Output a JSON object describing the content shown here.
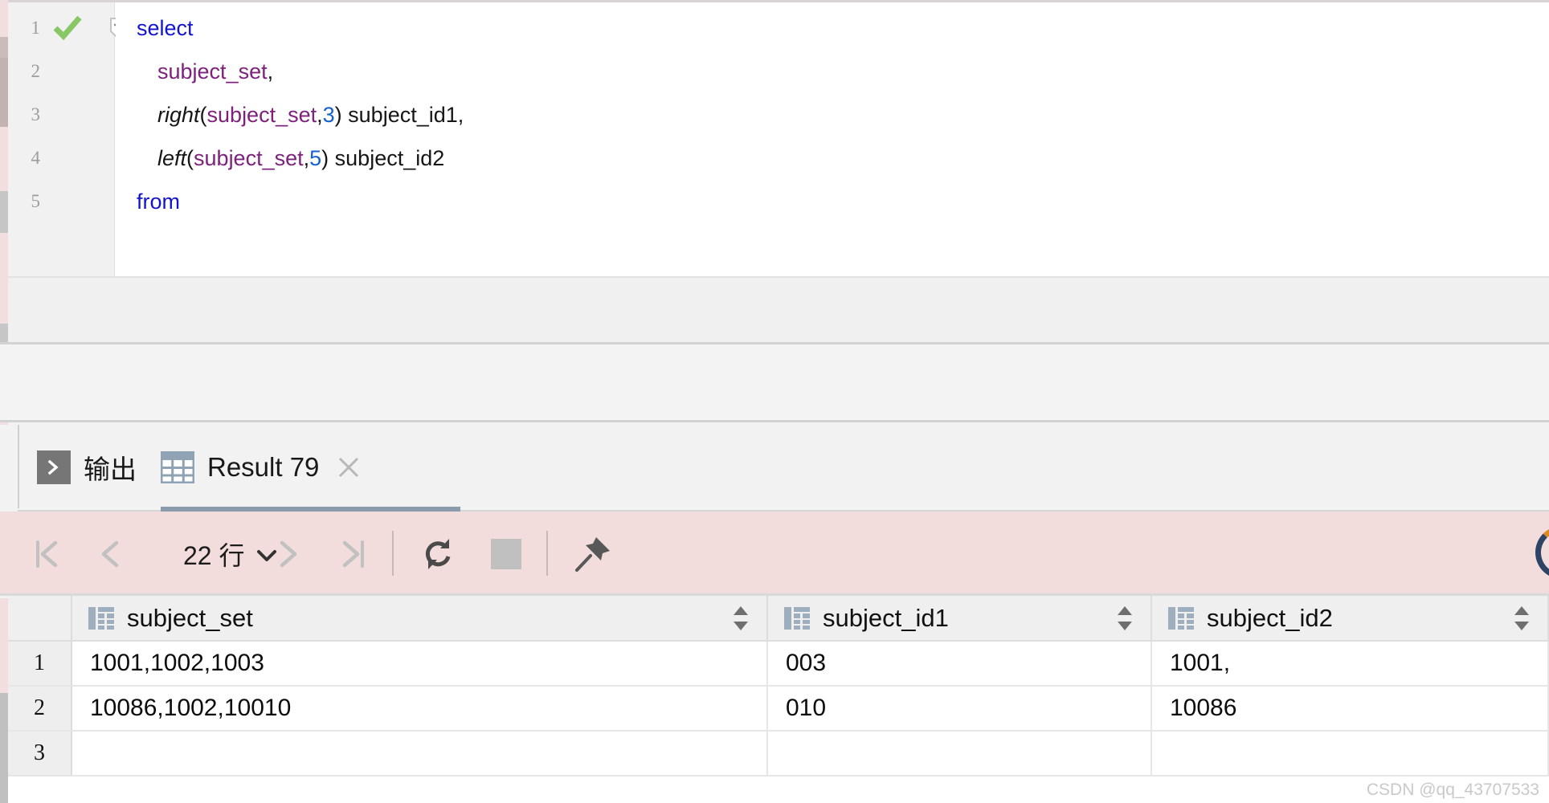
{
  "editor": {
    "lines": [
      {
        "number": "1",
        "indent": 0,
        "has_check": true,
        "has_fold": true,
        "tokens": [
          {
            "t": "select",
            "c": "kw"
          }
        ]
      },
      {
        "number": "2",
        "indent": 26,
        "has_check": false,
        "has_fold": false,
        "tokens": [
          {
            "t": "subject_set",
            "c": "ident"
          },
          {
            "t": ",",
            "c": "plain"
          }
        ]
      },
      {
        "number": "3",
        "indent": 26,
        "has_check": false,
        "has_fold": false,
        "tokens": [
          {
            "t": "right",
            "c": "fn"
          },
          {
            "t": "(",
            "c": "plain"
          },
          {
            "t": "subject_set",
            "c": "ident"
          },
          {
            "t": ",",
            "c": "plain"
          },
          {
            "t": "3",
            "c": "num"
          },
          {
            "t": ") subject_id1,",
            "c": "plain"
          }
        ]
      },
      {
        "number": "4",
        "indent": 26,
        "has_check": false,
        "has_fold": false,
        "tokens": [
          {
            "t": "left",
            "c": "fn"
          },
          {
            "t": "(",
            "c": "plain"
          },
          {
            "t": "subject_set",
            "c": "ident"
          },
          {
            "t": ",",
            "c": "plain"
          },
          {
            "t": "5",
            "c": "num"
          },
          {
            "t": ") subject_id2",
            "c": "plain"
          }
        ]
      },
      {
        "number": "5",
        "indent": 0,
        "has_check": false,
        "has_fold": false,
        "tokens": [
          {
            "t": "from",
            "c": "kw"
          }
        ]
      }
    ],
    "icons": {
      "check": "check-icon",
      "fold": "fold-collapse-icon"
    }
  },
  "tabs": [
    {
      "label": "输出",
      "icon": "console-icon",
      "active": false,
      "closable": false
    },
    {
      "label": "Result 79",
      "icon": "grid-icon",
      "active": true,
      "closable": true
    }
  ],
  "result_toolbar": {
    "first_page": "first-page-icon",
    "prev_page": "prev-page-icon",
    "rows_label": "22 行",
    "rows_chevron": "chevron-down-icon",
    "next_page": "next-page-icon",
    "last_page": "last-page-icon",
    "refresh": "refresh-icon",
    "stop": "stop-icon",
    "pin": "pin-icon",
    "busy_spinner": "loading-spinner-icon",
    "background_color": "#f2dcdc"
  },
  "result_grid": {
    "columns": [
      {
        "name": "subject_set",
        "icon": "column-icon",
        "sortable": true
      },
      {
        "name": "subject_id1",
        "icon": "column-icon",
        "sortable": true
      },
      {
        "name": "subject_id2",
        "icon": "column-icon",
        "sortable": true
      }
    ],
    "rows": [
      {
        "num": "1",
        "subject_set": "1001,1002,1003",
        "subject_id1": "003",
        "subject_id2": "1001,"
      },
      {
        "num": "2",
        "subject_set": "10086,1002,10010",
        "subject_id1": "010",
        "subject_id2": "10086"
      },
      {
        "num": "3",
        "subject_set": "",
        "subject_id1": "",
        "subject_id2": ""
      }
    ]
  },
  "watermark": {
    "text": "CSDN @qq_43707533"
  },
  "colors": {
    "keyword": "#1414cf",
    "identifier": "#7d217d",
    "number": "#1560d0",
    "toolbar_pink": "#f2dcdc",
    "tab_active_underline": "#8b9bae",
    "check_green": "#88c765"
  }
}
